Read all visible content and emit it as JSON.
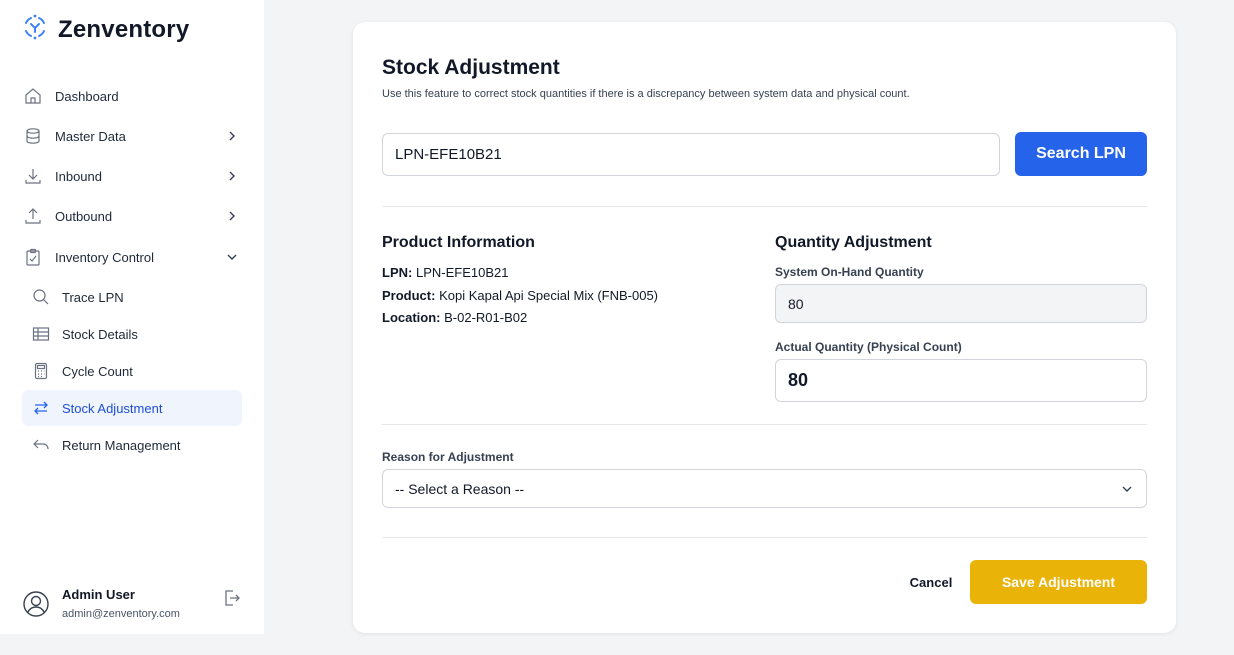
{
  "app": {
    "name": "Zenventory"
  },
  "sidebar": {
    "items": [
      {
        "label": "Dashboard",
        "icon": "home-icon"
      },
      {
        "label": "Master Data",
        "icon": "database-icon",
        "chevron": "chevron-right-icon"
      },
      {
        "label": "Inbound",
        "icon": "arrow-down-icon",
        "chevron": "chevron-right-icon"
      },
      {
        "label": "Outbound",
        "icon": "arrow-up-icon",
        "chevron": "chevron-right-icon"
      },
      {
        "label": "Inventory Control",
        "icon": "clipboard-check-icon",
        "chevron": "chevron-down-icon"
      }
    ],
    "sub_items": [
      {
        "label": "Trace LPN",
        "icon": "search-icon"
      },
      {
        "label": "Stock Details",
        "icon": "table-icon"
      },
      {
        "label": "Cycle Count",
        "icon": "calculator-icon"
      },
      {
        "label": "Stock Adjustment",
        "icon": "arrows-swap-icon",
        "active": true
      },
      {
        "label": "Return Management",
        "icon": "return-arrow-icon"
      }
    ],
    "user": {
      "name": "Admin User",
      "email": "admin@zenventory.com"
    }
  },
  "page": {
    "title": "Stock Adjustment",
    "subtitle": "Use this feature to correct stock quantities if there is a discrepancy between system data and physical count.",
    "search": {
      "value": "LPN-EFE10B21",
      "button_label": "Search LPN"
    },
    "product_info": {
      "heading": "Product Information",
      "lpn_label": "LPN:",
      "lpn_value": "LPN-EFE10B21",
      "product_label": "Product:",
      "product_value": "Kopi Kapal Api Special Mix (FNB-005)",
      "location_label": "Location:",
      "location_value": "B-02-R01-B02"
    },
    "quantity": {
      "heading": "Quantity Adjustment",
      "system_label": "System On-Hand Quantity",
      "system_value": "80",
      "actual_label": "Actual Quantity (Physical Count)",
      "actual_value": "80"
    },
    "reason": {
      "label": "Reason for Adjustment",
      "selected": "-- Select a Reason --"
    },
    "actions": {
      "cancel_label": "Cancel",
      "save_label": "Save Adjustment"
    }
  },
  "colors": {
    "primary": "#2563eb",
    "save": "#eab308",
    "active_bg": "#eff4fd",
    "logo": "#3b82f6"
  }
}
